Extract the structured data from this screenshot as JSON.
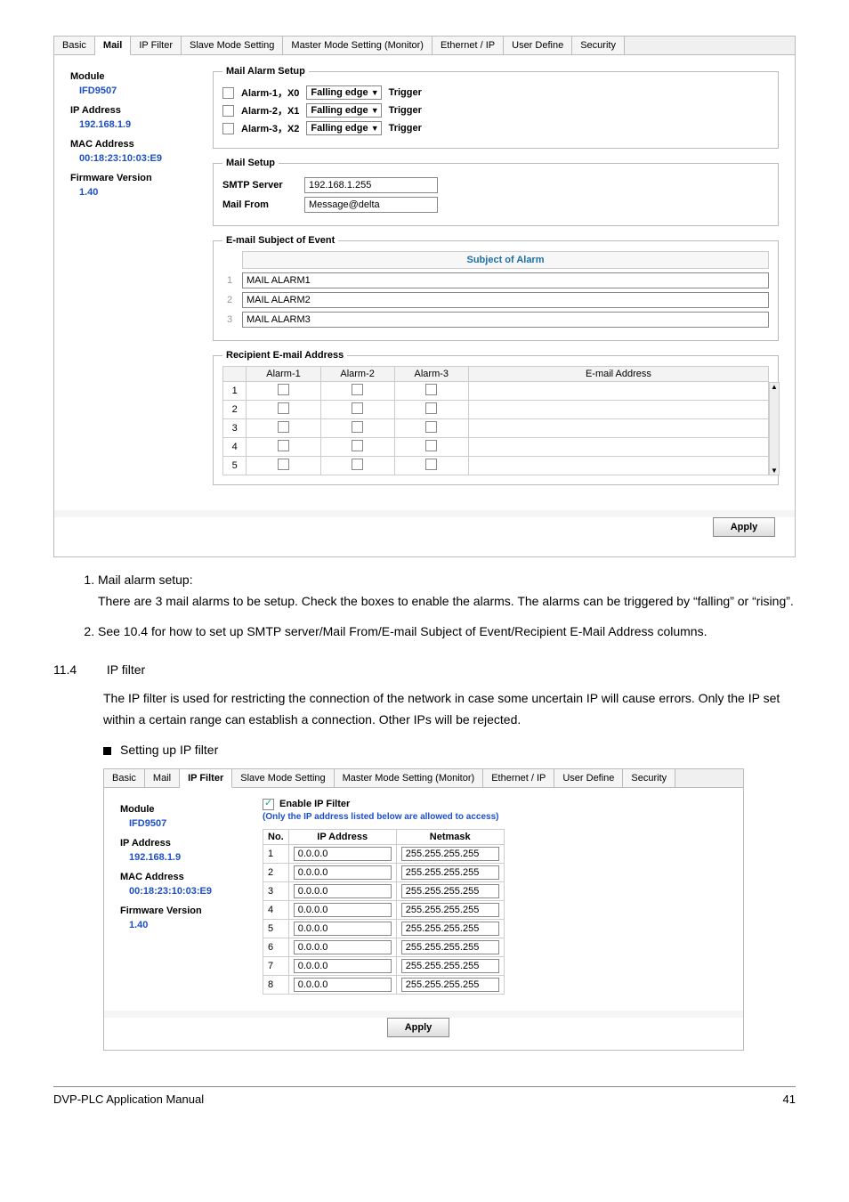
{
  "screenshot_mail": {
    "tabs": [
      "Basic",
      "Mail",
      "IP Filter",
      "Slave Mode Setting",
      "Master Mode Setting (Monitor)",
      "Ethernet / IP",
      "User Define",
      "Security"
    ],
    "active_tab_index": 1,
    "sidebar": {
      "module_label": "Module",
      "module_value": "IFD9507",
      "ip_label": "IP Address",
      "ip_value": "192.168.1.9",
      "mac_label": "MAC Address",
      "mac_value": "00:18:23:10:03:E9",
      "fw_label": "Firmware Version",
      "fw_value": "1.40"
    },
    "mail_alarm_setup": {
      "legend": "Mail Alarm Setup",
      "rows": [
        {
          "label": "Alarm-1，X0",
          "select": "Falling edge",
          "trigger": "Trigger"
        },
        {
          "label": "Alarm-2，X1",
          "select": "Falling edge",
          "trigger": "Trigger"
        },
        {
          "label": "Alarm-3，X2",
          "select": "Falling edge",
          "trigger": "Trigger"
        }
      ]
    },
    "mail_setup": {
      "legend": "Mail Setup",
      "smtp_label": "SMTP Server",
      "smtp_value": "192.168.1.255",
      "from_label": "Mail From",
      "from_value": "Message@delta"
    },
    "subject": {
      "legend": "E-mail Subject of Event",
      "header": "Subject of Alarm",
      "items": [
        "MAIL ALARM1",
        "MAIL ALARM2",
        "MAIL ALARM3"
      ]
    },
    "recipients": {
      "legend": "Recipient E-mail Address",
      "headers": [
        "",
        "Alarm-1",
        "Alarm-2",
        "Alarm-3",
        "E-mail Address"
      ],
      "rows": [
        1,
        2,
        3,
        4,
        5
      ]
    },
    "apply_label": "Apply"
  },
  "doc": {
    "list_item1_title": "Mail alarm setup:",
    "list_item1_body1": "There are 3 mail alarms to be setup. Check the boxes to enable the alarms. The alarms can be triggered by “falling” or “rising”.",
    "list_item2": "See 10.4 for how to set up SMTP server/Mail From/E-mail Subject of Event/Recipient E-Mail Address columns.",
    "section_num": "11.4",
    "section_title": "IP filter",
    "section_body": "The IP filter is used for restricting the connection of the network in case some uncertain IP will cause errors. Only the IP set within a certain range can establish a connection. Other IPs will be rejected.",
    "bullet": "Setting up IP filter"
  },
  "screenshot_ip": {
    "tabs": [
      "Basic",
      "Mail",
      "IP Filter",
      "Slave Mode Setting",
      "Master Mode Setting (Monitor)",
      "Ethernet / IP",
      "User Define",
      "Security"
    ],
    "active_tab_index": 2,
    "sidebar": {
      "module_label": "Module",
      "module_value": "IFD9507",
      "ip_label": "IP Address",
      "ip_value": "192.168.1.9",
      "mac_label": "MAC Address",
      "mac_value": "00:18:23:10:03:E9",
      "fw_label": "Firmware Version",
      "fw_value": "1.40"
    },
    "enable_label": "Enable IP Filter",
    "enable_desc": "(Only the IP address listed below are allowed to access)",
    "headers": {
      "no": "No.",
      "ip": "IP Address",
      "mask": "Netmask"
    },
    "rows": [
      {
        "n": 1,
        "ip": "0.0.0.0",
        "mask": "255.255.255.255"
      },
      {
        "n": 2,
        "ip": "0.0.0.0",
        "mask": "255.255.255.255"
      },
      {
        "n": 3,
        "ip": "0.0.0.0",
        "mask": "255.255.255.255"
      },
      {
        "n": 4,
        "ip": "0.0.0.0",
        "mask": "255.255.255.255"
      },
      {
        "n": 5,
        "ip": "0.0.0.0",
        "mask": "255.255.255.255"
      },
      {
        "n": 6,
        "ip": "0.0.0.0",
        "mask": "255.255.255.255"
      },
      {
        "n": 7,
        "ip": "0.0.0.0",
        "mask": "255.255.255.255"
      },
      {
        "n": 8,
        "ip": "0.0.0.0",
        "mask": "255.255.255.255"
      }
    ],
    "apply_label": "Apply"
  },
  "footer": {
    "left": "DVP-PLC Application Manual",
    "right": "41"
  }
}
